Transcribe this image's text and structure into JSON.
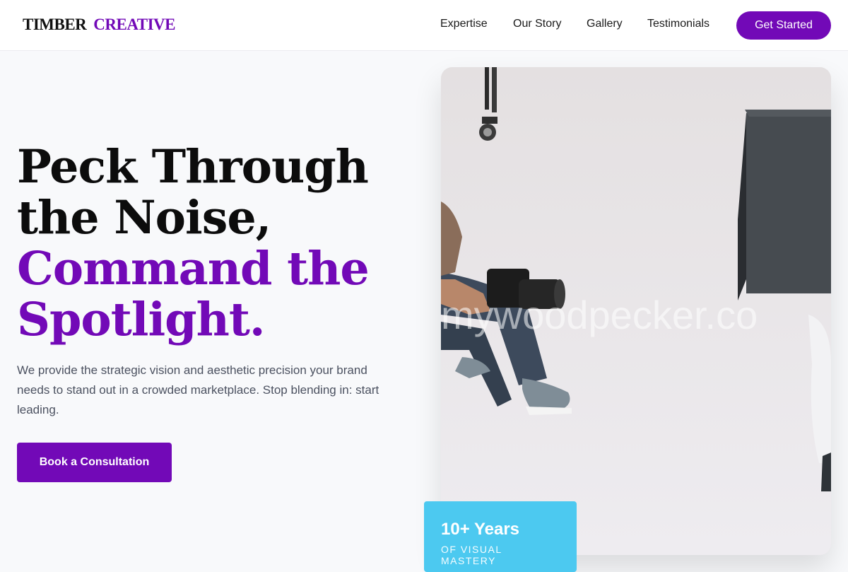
{
  "brand": {
    "word1": "TIMBER",
    "word2": "CREATIVE"
  },
  "nav": {
    "links": [
      "Expertise",
      "Our Story",
      "Gallery",
      "Testimonials"
    ],
    "cta": "Get Started"
  },
  "hero": {
    "title_line1": "Peck Through",
    "title_line2": "the Noise,",
    "title_line3": "Command the",
    "title_line4": "Spotlight.",
    "subtitle": "We provide the strategic vision and aesthetic precision your brand needs to stand out in a crowded marketplace. Stop blending in: start leading.",
    "button": "Book a Consultation"
  },
  "image": {
    "watermark": "mywoodpecker.co"
  },
  "stats": {
    "value": "10+ Years",
    "label": "OF VISUAL MASTERY"
  },
  "colors": {
    "accent": "#7209b7",
    "badge": "#4cc9f0",
    "background": "#f8f9fb"
  }
}
